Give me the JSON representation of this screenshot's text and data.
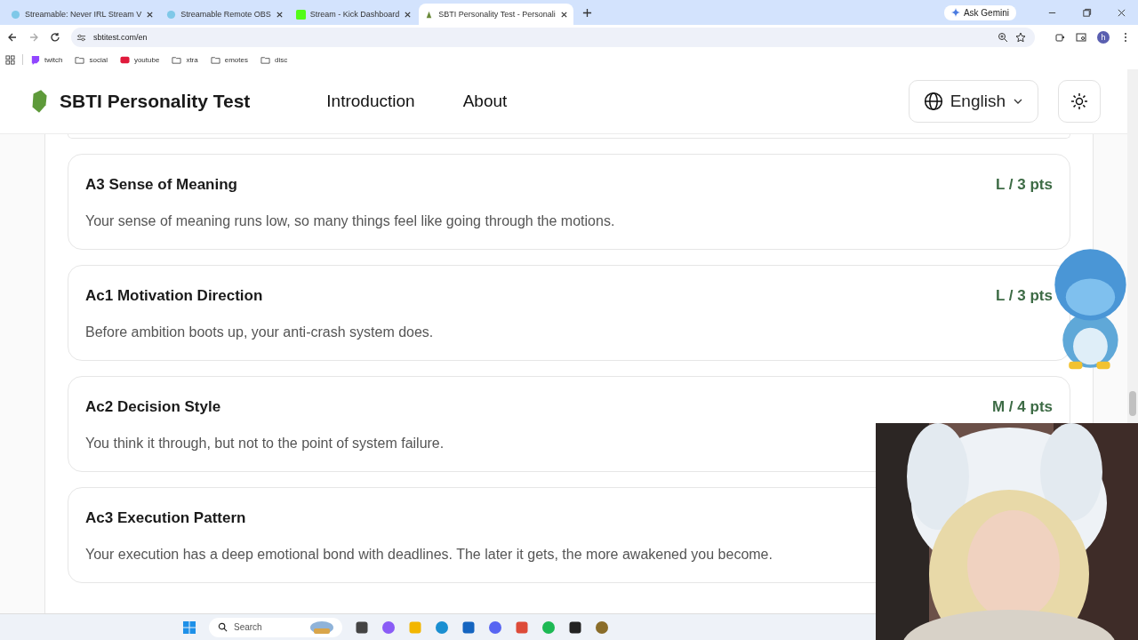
{
  "browser": {
    "tabs": [
      {
        "title": "Streamable: Never IRL Stream V",
        "selected": false
      },
      {
        "title": "Streamable Remote OBS",
        "selected": false
      },
      {
        "title": "Stream - Kick Dashboard",
        "selected": false
      },
      {
        "title": "SBTI Personality Test - Personali",
        "selected": true
      }
    ],
    "ask_gemini": "Ask Gemini",
    "address": "sbtitest.com/en",
    "profile": "h",
    "bookmarks": [
      {
        "label": "twitch",
        "kind": "twitch"
      },
      {
        "label": "social",
        "kind": "folder"
      },
      {
        "label": "youtube",
        "kind": "youtube"
      },
      {
        "label": "xtra",
        "kind": "folder"
      },
      {
        "label": "emotes",
        "kind": "folder"
      },
      {
        "label": "disc",
        "kind": "folder"
      }
    ]
  },
  "header": {
    "site_name": "SBTI Personality Test",
    "nav": [
      "Introduction",
      "About"
    ],
    "language": "English"
  },
  "cards": [
    {
      "title": "A3 Sense of Meaning",
      "score": "L / 3 pts",
      "description": "Your sense of meaning runs low, so many things feel like going through the motions."
    },
    {
      "title": "Ac1 Motivation Direction",
      "score": "L / 3 pts",
      "description": "Before ambition boots up, your anti-crash system does."
    },
    {
      "title": "Ac2 Decision Style",
      "score": "M / 4 pts",
      "description": "You think it through, but not to the point of system failure."
    },
    {
      "title": "Ac3 Execution Pattern",
      "description": "Your execution has a deep emotional bond with deadlines. The later it gets, the more awakened you become."
    }
  ],
  "taskbar": {
    "search_placeholder": "Search"
  }
}
